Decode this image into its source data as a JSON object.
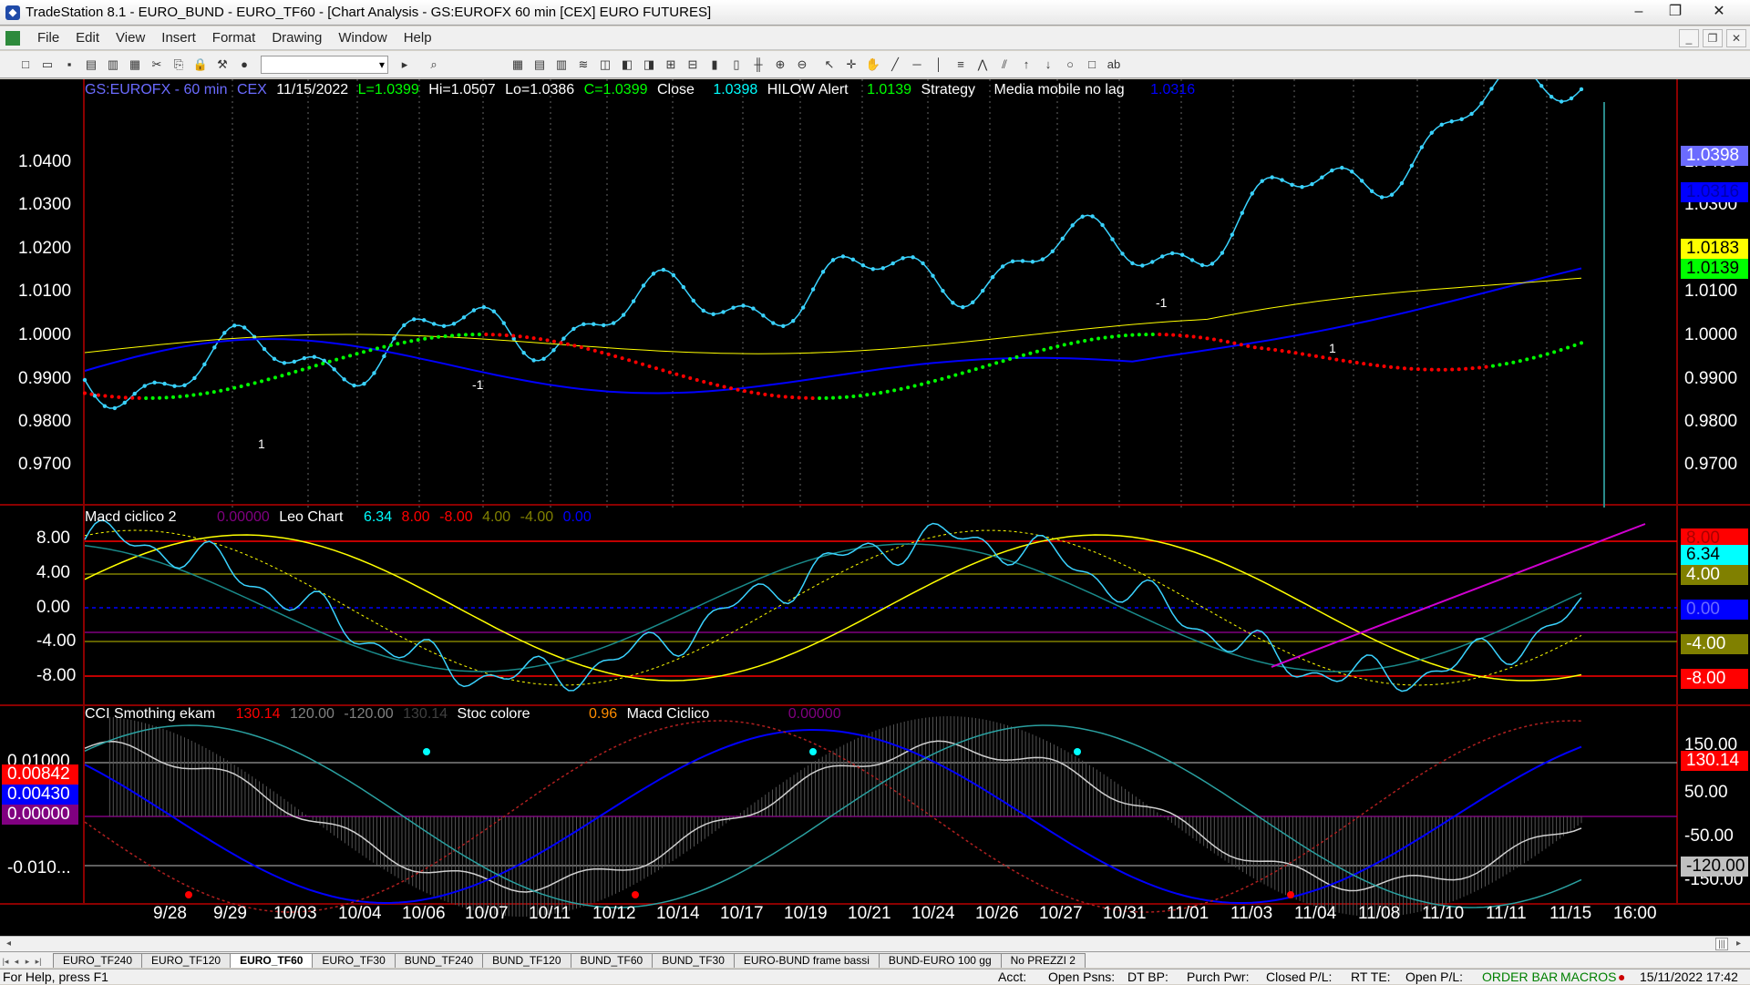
{
  "window": {
    "title": "TradeStation 8.1 - EURO_BUND - EURO_TF60 - [Chart Analysis - GS:EUROFX  60 min  [CEX] EURO FUTURES]"
  },
  "menu": [
    "File",
    "Edit",
    "View",
    "Insert",
    "Format",
    "Drawing",
    "Window",
    "Help"
  ],
  "header": {
    "symbol": "GS:EUROFX - 60 min",
    "exchange": "CEX",
    "date": "11/15/2022",
    "last": "L=1.0399",
    "high": "Hi=1.0507",
    "low": "Lo=1.0386",
    "close": "C=1.0399",
    "close_label": "Close",
    "close_value": "1.0398",
    "hilow_label": "HILOW Alert",
    "hilow_value": "1.0139",
    "strategy_label": "Strategy",
    "ma_label": "Media mobile no lag",
    "ma_value": "1.0316"
  },
  "macd_header": {
    "name": "Macd ciclico 2",
    "v1": "0.00000",
    "leo": "Leo Chart",
    "v2": "6.34",
    "v3": "8.00",
    "v4": "-8.00",
    "v5": "4.00",
    "v6": "-4.00",
    "v7": "0.00"
  },
  "cci_header": {
    "name": "CCI Smothing ekam",
    "v1": "130.14",
    "v2": "120.00",
    "v3": "-120.00",
    "v4": "130.14",
    "stoc": "Stoc colore",
    "stoc_v": "0.96",
    "macd": "Macd Ciclico",
    "macd_v": "0.00000"
  },
  "price_axis": [
    "1.0400",
    "1.0300",
    "1.0200",
    "1.0100",
    "1.0000",
    "0.9900",
    "0.9800",
    "0.9700"
  ],
  "price_tags": [
    {
      "text": "1.0398",
      "bg": "#6b6bff",
      "fg": "#ffffff"
    },
    {
      "text": "1.0316",
      "bg": "#0000ff",
      "fg": "#0000aa"
    },
    {
      "text": "1.0183",
      "bg": "#ffff00",
      "fg": "#000000"
    },
    {
      "text": "1.0139",
      "bg": "#00ff00",
      "fg": "#000000"
    }
  ],
  "macd_axis": [
    "8.00",
    "4.00",
    "0.00",
    "-4.00",
    "-8.00"
  ],
  "macd_tags": [
    {
      "text": "8.00",
      "bg": "#ff0000",
      "fg": "#aa0000"
    },
    {
      "text": "6.34",
      "bg": "#00ffff",
      "fg": "#000000"
    },
    {
      "text": "4.00",
      "bg": "#808000",
      "fg": "#ffffff"
    },
    {
      "text": "0.00",
      "bg": "#0000ff",
      "fg": "#6b6bff"
    },
    {
      "text": "-4.00",
      "bg": "#808000",
      "fg": "#ffffff"
    },
    {
      "text": "-8.00",
      "bg": "#ff0000",
      "fg": "#ffffff"
    }
  ],
  "cci_left_axis": [
    "0.01000",
    "-0.010..."
  ],
  "cci_left_tags": [
    {
      "text": "0.00842",
      "bg": "#ff0000",
      "fg": "#ffffff"
    },
    {
      "text": "0.00430",
      "bg": "#0000ff",
      "fg": "#ffffff"
    },
    {
      "text": "0.00000",
      "bg": "#800080",
      "fg": "#ffffff"
    }
  ],
  "cci_right_axis": [
    "150.00",
    "50.00",
    "-50.00",
    "-150.00"
  ],
  "cci_right_tags": [
    {
      "text": "130.14",
      "bg": "#ff0000",
      "fg": "#ffffff"
    },
    {
      "text": "-120.00",
      "bg": "#c0c0c0",
      "fg": "#000000"
    }
  ],
  "x_axis": [
    "9/28",
    "9/29",
    "10/03",
    "10/04",
    "10/06",
    "10/07",
    "10/11",
    "10/12",
    "10/14",
    "10/17",
    "10/19",
    "10/21",
    "10/24",
    "10/26",
    "10/27",
    "10/31",
    "11/01",
    "11/03",
    "11/04",
    "11/08",
    "11/10",
    "11/11",
    "11/15",
    "16:00"
  ],
  "signals": {
    "buy": "1",
    "sell": "-1"
  },
  "tabs": [
    "EURO_TF240",
    "EURO_TF120",
    "EURO_TF60",
    "EURO_TF30",
    "BUND_TF240",
    "BUND_TF120",
    "BUND_TF60",
    "BUND_TF30",
    "EURO-BUND frame bassi",
    "BUND-EURO 100 gg",
    "No PREZZI 2"
  ],
  "active_tab": "EURO_TF60",
  "status": {
    "help": "For Help, press F1",
    "acct": "Acct:",
    "open_psns": "Open Psns:",
    "dtbp": "DT BP:",
    "purch": "Purch Pwr:",
    "closed_pl": "Closed P/L:",
    "rtte": "RT TE:",
    "open_pl": "Open P/L:",
    "orderbar": "ORDER BAR",
    "macros": "MACROS",
    "datetime": "15/11/2022 17:42"
  }
}
